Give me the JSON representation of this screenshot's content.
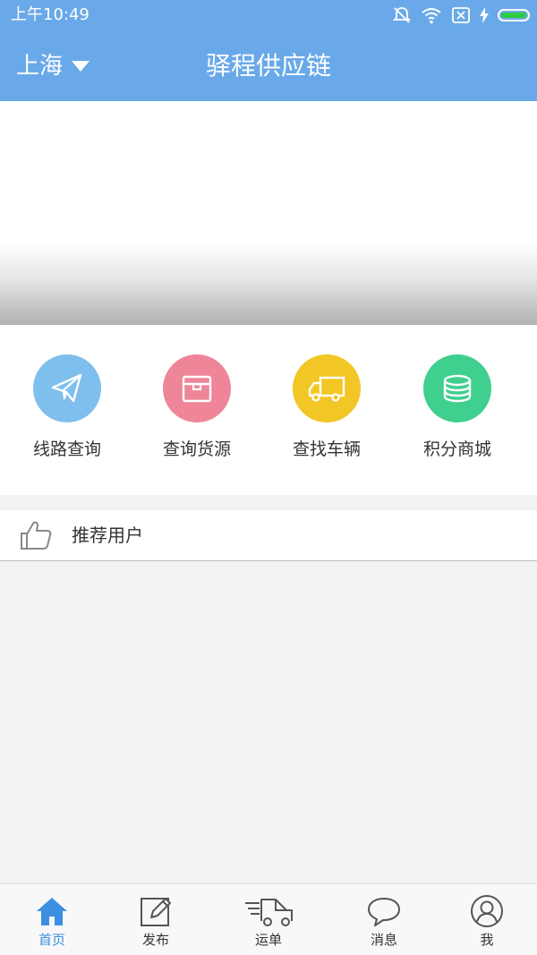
{
  "status_bar": {
    "time": "上午10:49",
    "battery_color": "#2ecc40"
  },
  "header": {
    "city": "上海",
    "title": "驿程供应链",
    "background_color": "#6aa9e9"
  },
  "features": [
    {
      "label": "线路查询",
      "icon": "paper-plane-icon",
      "color": "#7fbfee"
    },
    {
      "label": "查询货源",
      "icon": "box-icon",
      "color": "#ee8599"
    },
    {
      "label": "查找车辆",
      "icon": "truck-icon",
      "color": "#f2c624"
    },
    {
      "label": "积分商城",
      "icon": "coins-stack-icon",
      "color": "#3fcf8e"
    }
  ],
  "recommend": {
    "title": "推荐用户",
    "icon": "thumbs-up-icon"
  },
  "tabbar": {
    "active_color": "#3d8fe0",
    "items": [
      {
        "label": "首页",
        "icon": "home-icon",
        "active": true
      },
      {
        "label": "发布",
        "icon": "edit-icon",
        "active": false
      },
      {
        "label": "运单",
        "icon": "delivery-truck-icon",
        "active": false
      },
      {
        "label": "消息",
        "icon": "chat-bubble-icon",
        "active": false
      },
      {
        "label": "我",
        "icon": "user-icon",
        "active": false
      }
    ]
  }
}
